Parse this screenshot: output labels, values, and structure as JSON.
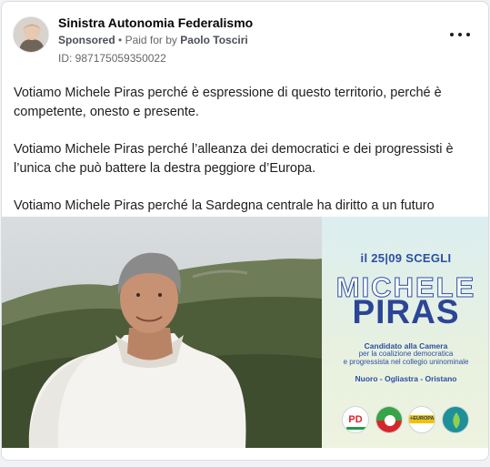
{
  "post": {
    "page_name": "Sinistra Autonomia Federalismo",
    "sponsored_label": "Sponsored",
    "separator": "•",
    "paid_for_prefix": "Paid for by",
    "paid_for_name": "Paolo Tosciri",
    "library_id": "ID: 987175059350022",
    "more_icon": "more-horizontal-icon",
    "paragraphs": [
      "Votiamo Michele Piras perché è espressione di questo territorio, perché è competente, onesto e presente.",
      "Votiamo Michele Piras perché l’alleanza dei democratici e dei progressisti è l’unica che può battere la destra peggiore d’Europa.",
      "Votiamo Michele Piras perché la Sardegna centrale ha diritto a un futuro migliore,..."
    ]
  },
  "creative": {
    "date_line": "il 25|09 SCEGLI",
    "first_name": "MICHELE",
    "last_name": "PIRAS",
    "role_line_1": "Candidato alla Camera",
    "role_line_2": "per la coalizione democratica",
    "role_line_3": "e progressista nel collegio uninominale",
    "role_line_4": "Nuoro - Ogliastra - Oristano",
    "logos": [
      {
        "name": "pd-logo",
        "text": "PD",
        "color": "#d7262b"
      },
      {
        "name": "verdi-sinistra-logo",
        "text": "",
        "color": "#37a447"
      },
      {
        "name": "europa-logo",
        "text": "+EUROPA",
        "color": "#f2c200"
      },
      {
        "name": "impegno-civico-logo",
        "text": "",
        "color": "#1f8f9a"
      }
    ],
    "colors": {
      "accent": "#2c4ea3",
      "panel_bg": "#e4f0e6"
    }
  }
}
